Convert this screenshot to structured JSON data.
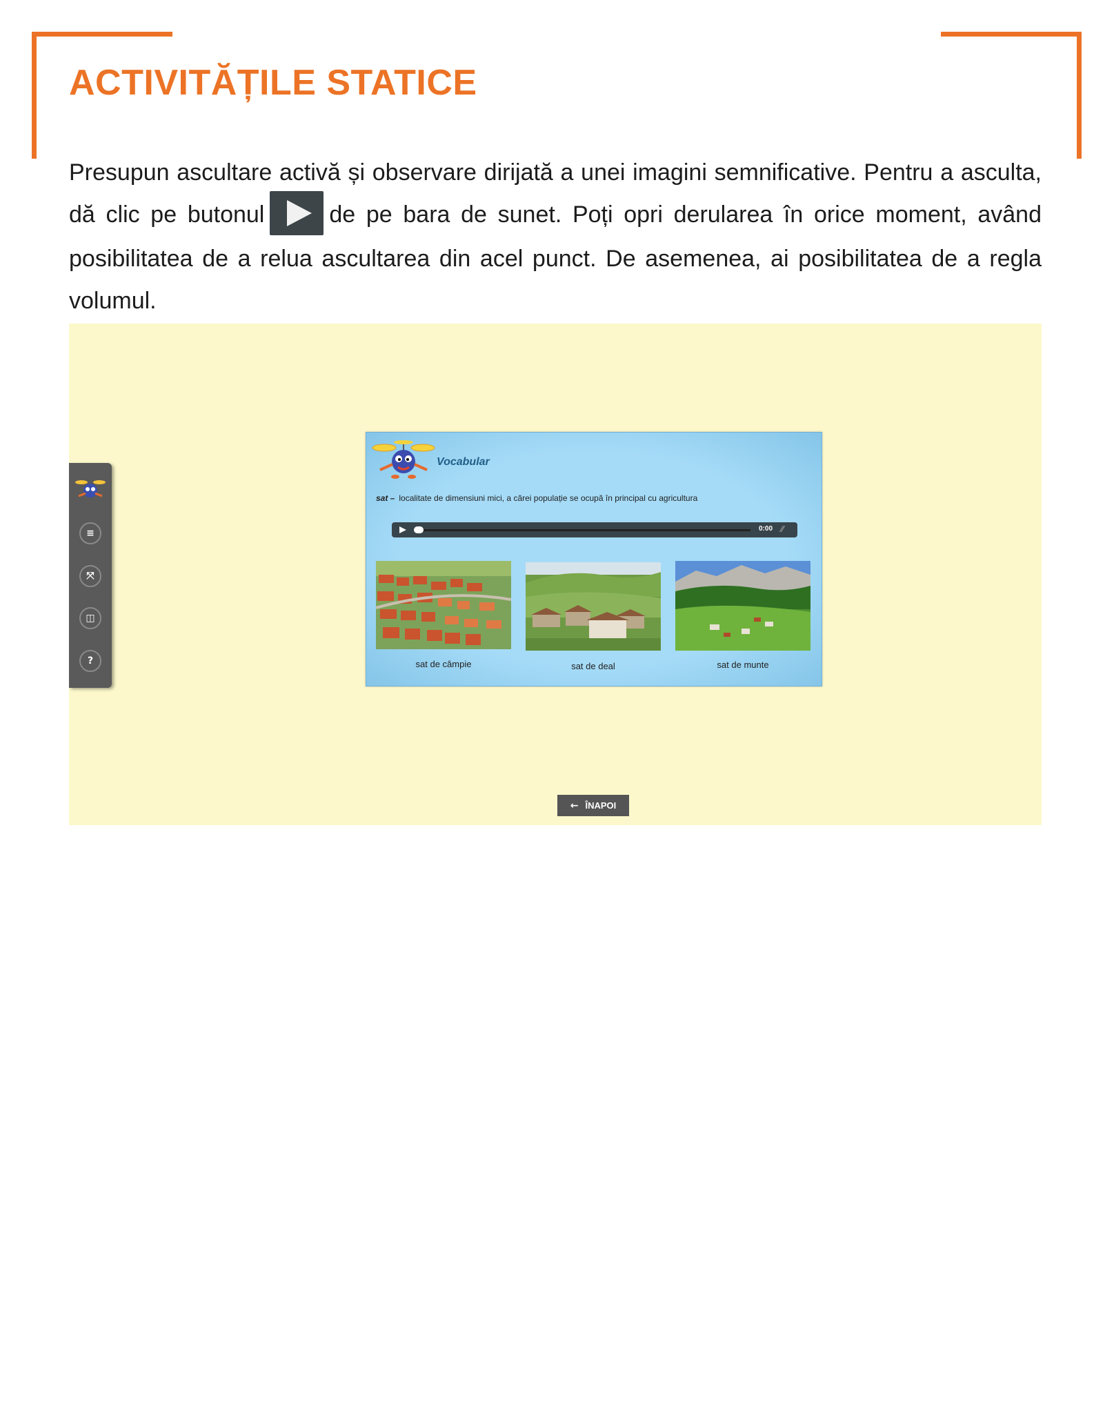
{
  "page": {
    "title": "ACTIVITĂȚILE STATICE",
    "intro_before": "Presupun ascultare activă și observare dirijată a unei imagini semnificative. Pentru a asculta, dă clic pe butonul",
    "intro_after": "de pe bara de sunet. Poți opri derularea în orice moment, având posibilitatea de a relua ascultarea din acel punct. De asemenea, ai posibilitatea de a regla volumul."
  },
  "toolbar": {
    "buttons": [
      {
        "name": "menu-icon",
        "glyph": "≡"
      },
      {
        "name": "fullscreen-icon",
        "glyph": "⤧"
      },
      {
        "name": "layout-icon",
        "glyph": "◫"
      },
      {
        "name": "help-icon",
        "glyph": "?"
      }
    ]
  },
  "vocabulary": {
    "title": "Vocabular",
    "term": "sat –",
    "definition": "localitate de dimensiuni mici, a cărei populație se ocupă în principal cu agricultura",
    "audio": {
      "time": "0:00"
    },
    "images": [
      {
        "caption": "sat de câmpie"
      },
      {
        "caption": "sat de deal"
      },
      {
        "caption": "sat de munte"
      }
    ]
  },
  "navigation": {
    "back_label": "ÎNAPOI"
  },
  "colors": {
    "accent": "#ec7326",
    "stage_bg": "#fcf8cb",
    "screen_bg": "#a5dbf7",
    "toolbar_bg": "#5a5a5a"
  }
}
